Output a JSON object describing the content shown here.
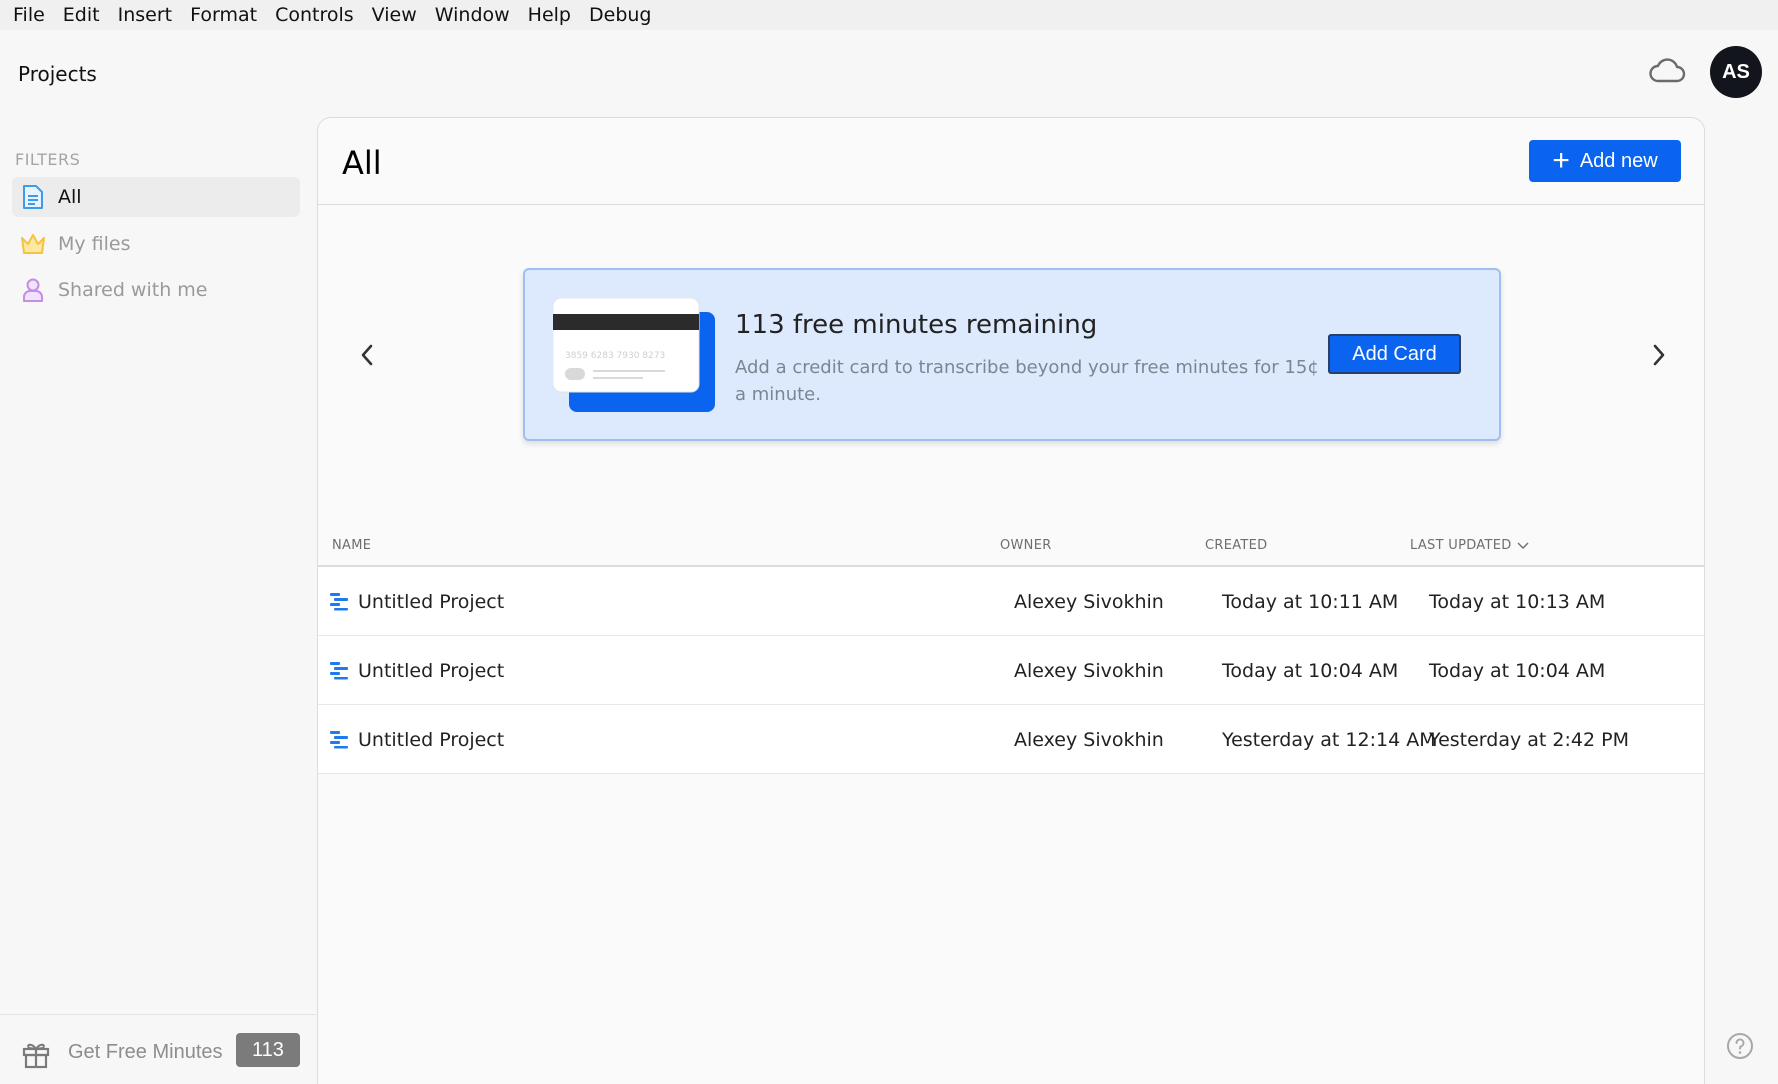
{
  "menu": [
    "File",
    "Edit",
    "Insert",
    "Format",
    "Controls",
    "View",
    "Window",
    "Help",
    "Debug"
  ],
  "header": {
    "app_title": "Projects",
    "avatar_initials": "AS",
    "cloud_icon": "cloud-icon"
  },
  "sidebar": {
    "filters_label": "FILTERS",
    "items": [
      {
        "label": "All",
        "icon": "document-icon",
        "active": true
      },
      {
        "label": "My files",
        "icon": "crown-icon",
        "active": false
      },
      {
        "label": "Shared with me",
        "icon": "person-icon",
        "active": false
      }
    ],
    "free_minutes_label": "Get Free Minutes",
    "free_minutes_count": "113"
  },
  "main": {
    "title": "All",
    "add_new_label": "Add new",
    "promo": {
      "title": "113 free minutes remaining",
      "subtitle": "Add a credit card to transcribe beyond your free minutes for 15¢ a minute.",
      "button_label": "Add Card",
      "card_number": "3859 6283 7930 8273"
    },
    "table": {
      "columns": [
        "NAME",
        "OWNER",
        "CREATED",
        "LAST UPDATED"
      ],
      "rows": [
        {
          "name": "Untitled Project",
          "owner": "Alexey Sivokhin",
          "created": "Today at 10:11 AM",
          "updated": "Today at 10:13 AM"
        },
        {
          "name": "Untitled Project",
          "owner": "Alexey Sivokhin",
          "created": "Today at 10:04 AM",
          "updated": "Today at 10:04 AM"
        },
        {
          "name": "Untitled Project",
          "owner": "Alexey Sivokhin",
          "created": "Yesterday at 12:14 AM",
          "updated": "Yesterday at 2:42 PM"
        }
      ]
    }
  },
  "colors": {
    "accent": "#0a64f0",
    "promo_bg": "#dde9fc",
    "avatar_bg": "#12151c"
  }
}
